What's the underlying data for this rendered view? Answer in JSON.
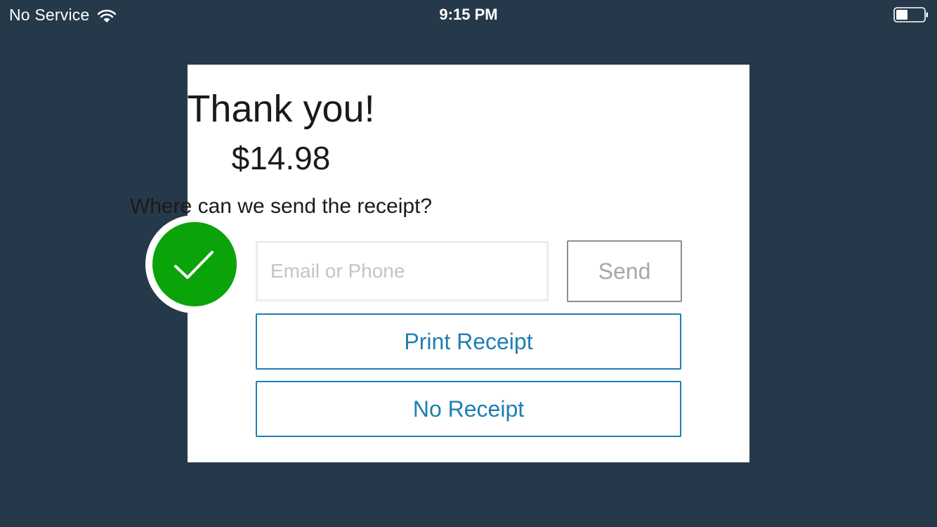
{
  "status_bar": {
    "carrier": "No Service",
    "time": "9:15 PM",
    "wifi_icon": "wifi-icon",
    "battery_icon": "battery-icon"
  },
  "receipt_dialog": {
    "title": "Thank you!",
    "amount": "$14.98",
    "prompt": "Where can we send the receipt?",
    "contact_input": {
      "value": "",
      "placeholder": "Email or Phone"
    },
    "send_label": "Send",
    "print_label": "Print Receipt",
    "no_receipt_label": "No Receipt",
    "success_icon": "checkmark-icon"
  },
  "colors": {
    "background": "#26394a",
    "card": "#ffffff",
    "accent": "#1e7fb1",
    "success": "#0aa30a",
    "send_border": "#8e8e8e",
    "send_text": "#a8a8a8",
    "input_border": "#ececec",
    "placeholder": "#c4c4c4"
  }
}
